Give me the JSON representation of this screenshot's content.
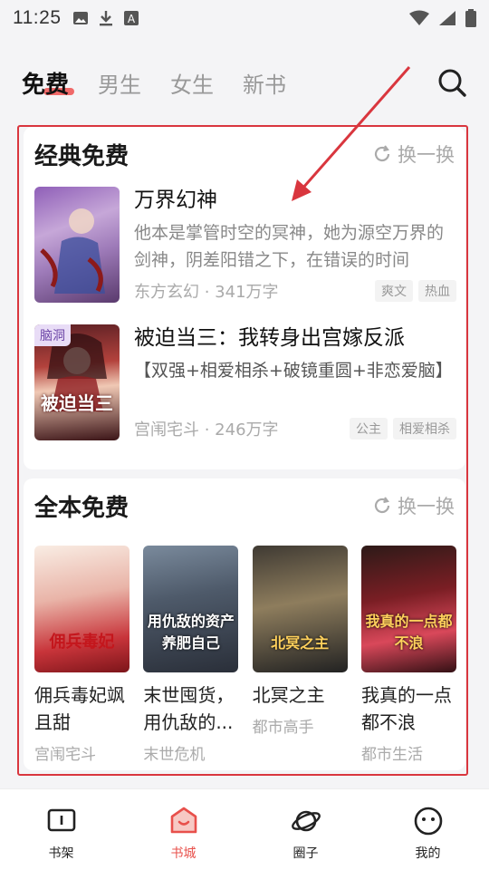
{
  "status_bar": {
    "time": "11:25",
    "icons": [
      "image-icon",
      "download-icon",
      "font-icon",
      "wifi-icon",
      "signal-icon",
      "battery-icon"
    ]
  },
  "top_tabs": [
    {
      "label": "免费",
      "active": true
    },
    {
      "label": "男生",
      "active": false
    },
    {
      "label": "女生",
      "active": false
    },
    {
      "label": "新书",
      "active": false
    }
  ],
  "section_classic": {
    "title": "经典免费",
    "refresh_label": "换一换",
    "books": [
      {
        "title": "万界幻神",
        "description": "他本是掌管时空的冥神，她为源空万界的剑神，阴差阳错之下，在错误的时间",
        "meta": "东方玄幻 · 341万字",
        "tags": [
          "爽文",
          "热血"
        ]
      },
      {
        "title": "被迫当三：我转身出宫嫁反派",
        "description": "【双强+相爱相杀+破镜重圆+非恋爱脑】",
        "meta": "宫闱宅斗 · 246万字",
        "tags": [
          "公主",
          "相爱相杀"
        ],
        "badge": "脑洞",
        "cover_text": "被迫当三"
      }
    ]
  },
  "section_full": {
    "title": "全本免费",
    "refresh_label": "换一换",
    "books": [
      {
        "title": "佣兵毒妃飒且甜",
        "category": "宫闱宅斗",
        "cover_text": "佣兵毒妃"
      },
      {
        "title": "末世囤货，用仇敌的...",
        "category": "末世危机",
        "cover_text": "用仇敌的资产养肥自己"
      },
      {
        "title": "北冥之主",
        "category": "都市高手",
        "cover_text": "北冥之主"
      },
      {
        "title": "我真的一点都不浪",
        "category": "都市生活",
        "cover_text": "我真的一点都不浪"
      }
    ]
  },
  "bottom_nav": [
    {
      "label": "书架",
      "icon": "bookshelf-icon",
      "active": false
    },
    {
      "label": "书城",
      "icon": "bookstore-icon",
      "active": true
    },
    {
      "label": "圈子",
      "icon": "planet-icon",
      "active": false
    },
    {
      "label": "我的",
      "icon": "profile-icon",
      "active": false
    }
  ],
  "colors": {
    "accent": "#e8504b",
    "annotation": "#d9363e"
  }
}
